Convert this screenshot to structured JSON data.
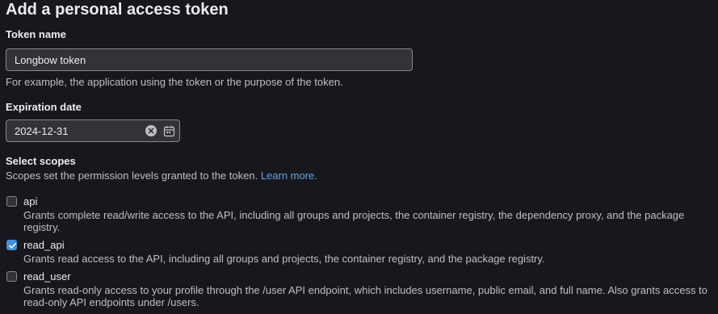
{
  "page": {
    "title": "Add a personal access token"
  },
  "token_name": {
    "label": "Token name",
    "value": "Longbow token",
    "help": "For example, the application using the token or the purpose of the token."
  },
  "expiration": {
    "label": "Expiration date",
    "value": "2024-12-31"
  },
  "scopes": {
    "label": "Select scopes",
    "help": "Scopes set the permission levels granted to the token.",
    "learn_more": "Learn more.",
    "items": [
      {
        "name": "api",
        "checked": false,
        "description": "Grants complete read/write access to the API, including all groups and projects, the container registry, the dependency proxy, and the package registry."
      },
      {
        "name": "read_api",
        "checked": true,
        "description": "Grants read access to the API, including all groups and projects, the container registry, and the package registry."
      },
      {
        "name": "read_user",
        "checked": false,
        "description": "Grants read-only access to your profile through the /user API endpoint, which includes username, public email, and full name. Also grants access to read-only API endpoints under /users."
      }
    ]
  },
  "colors": {
    "background": "#18171d",
    "input_background": "#333238",
    "accent": "#428fdc",
    "link": "#63a6e9"
  }
}
